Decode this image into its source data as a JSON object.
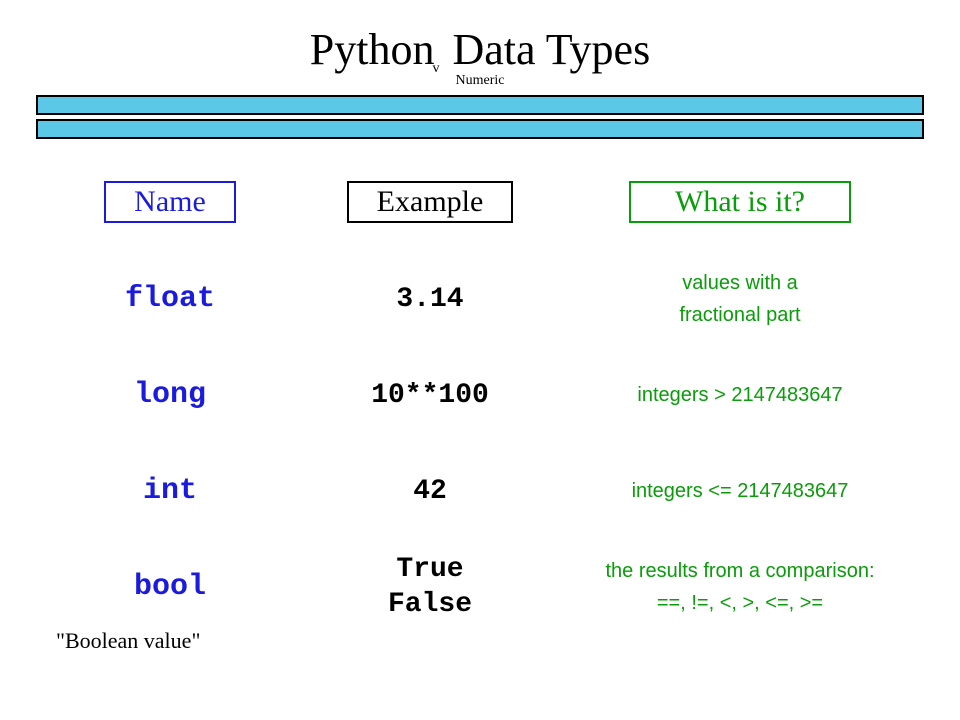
{
  "title": {
    "before": "Python",
    "sub": "v",
    "after": " Data Types"
  },
  "subtitle": "Numeric",
  "headers": {
    "name": "Name",
    "example": "Example",
    "what": "What is it?"
  },
  "rows": [
    {
      "name": "float",
      "example": "3.14",
      "what": "values with a\nfractional part"
    },
    {
      "name": "long",
      "example": "10**100",
      "what": "integers > 2147483647"
    },
    {
      "name": "int",
      "example": "42",
      "what": "integers <= 2147483647"
    },
    {
      "name": "bool",
      "example": "True\nFalse",
      "what": "the results from a comparison:\n==, !=, <, >, <=, >="
    }
  ],
  "footer": "\"Boolean value\""
}
